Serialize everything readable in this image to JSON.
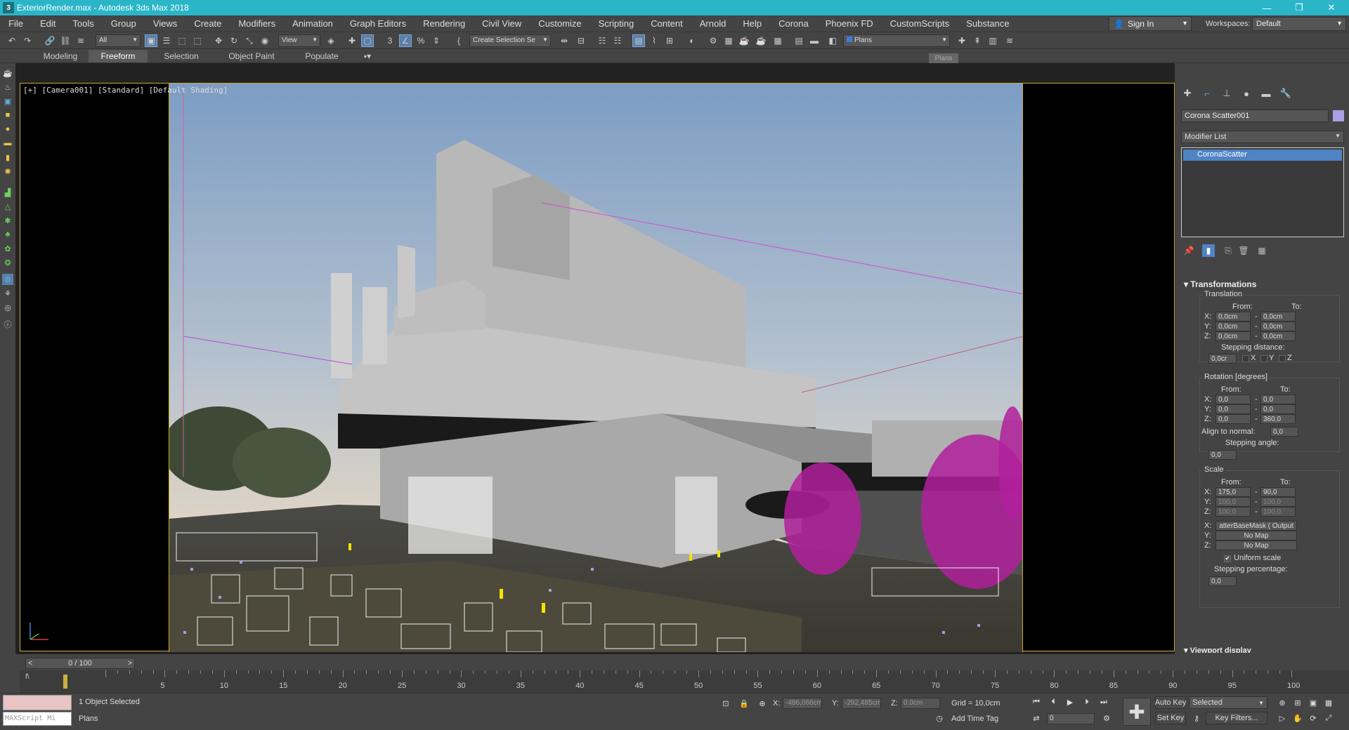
{
  "window": {
    "title": "ExteriorRender.max - Autodesk 3ds Max 2018",
    "app_icon": "3ds-max-icon"
  },
  "menu": [
    "File",
    "Edit",
    "Tools",
    "Group",
    "Views",
    "Create",
    "Modifiers",
    "Animation",
    "Graph Editors",
    "Rendering",
    "Civil View",
    "Customize",
    "Scripting",
    "Content",
    "Arnold",
    "Help",
    "Corona",
    "Phoenix FD",
    "CustomScripts",
    "Substance"
  ],
  "signin": {
    "label": "Sign In"
  },
  "workspaces": {
    "label": "Workspaces:",
    "value": "Default"
  },
  "toolbar": {
    "filter_value": "All",
    "refcoord_value": "View",
    "selection_set_value": "Create Selection Se",
    "layer_value": "Plans"
  },
  "ribbon": {
    "tabs": [
      "Modeling",
      "Freeform",
      "Selection",
      "Object Paint",
      "Populate"
    ],
    "active": "Freeform"
  },
  "tooltip": "Plans",
  "viewport": {
    "label": "[+] [Camera001] [Standard] [Default Shading]"
  },
  "command_panel": {
    "object_name": "Corona Scatter001",
    "object_color": "#a9a0e8",
    "modifier_list_label": "Modifier List",
    "modifier_stack": [
      "CoronaScatter"
    ],
    "rollout_title": "Transformations",
    "translation": {
      "title": "Translation",
      "from_label": "From:",
      "to_label": "To:",
      "rows": [
        {
          "axis": "X:",
          "from": "0,0cm",
          "to": "0,0cm"
        },
        {
          "axis": "Y:",
          "from": "0,0cm",
          "to": "0,0cm"
        },
        {
          "axis": "Z:",
          "from": "0,0cm",
          "to": "0,0cm"
        }
      ],
      "stepping_label": "Stepping distance:",
      "stepping_value": "0,0cr"
    },
    "rotation": {
      "title": "Rotation [degrees]",
      "from_label": "From:",
      "to_label": "To:",
      "rows": [
        {
          "axis": "X:",
          "from": "0,0",
          "to": "0,0"
        },
        {
          "axis": "Y:",
          "from": "0,0",
          "to": "0,0"
        },
        {
          "axis": "Z:",
          "from": "0,0",
          "to": "360,0"
        }
      ],
      "align_label": "Align to normal:",
      "align_value": "0,0",
      "stepping_label": "Stepping angle:",
      "stepping_value": "0,0"
    },
    "scale": {
      "title": "Scale",
      "from_label": "From:",
      "to_label": "To:",
      "rows": [
        {
          "axis": "X:",
          "from": "175,0",
          "to": "90,0"
        },
        {
          "axis": "Y:",
          "from": "100,0",
          "to": "100,0"
        },
        {
          "axis": "Z:",
          "from": "100,0",
          "to": "100,0"
        }
      ],
      "maps": [
        {
          "axis": "X:",
          "value": "atterBaseMask ( Output"
        },
        {
          "axis": "Y:",
          "value": "No Map"
        },
        {
          "axis": "Z:",
          "value": "No Map"
        }
      ],
      "uniform_label": "Uniform scale",
      "stepping_label": "Stepping percentage:",
      "stepping_value": "0,0"
    },
    "axes": [
      "X",
      "Y",
      "Z"
    ],
    "next_rollout": "Viewport display"
  },
  "timeline": {
    "frame_display": "0 / 100",
    "ticks": [
      "5",
      "10",
      "15",
      "20",
      "25",
      "30",
      "35",
      "40",
      "45",
      "50",
      "55",
      "60",
      "65",
      "70",
      "75",
      "80",
      "85",
      "90",
      "95",
      "100"
    ]
  },
  "status": {
    "selected": "1 Object Selected",
    "prompt": "Plans",
    "maxscript": "MAXScript Mi",
    "x_label": "X:",
    "x_value": "-486,066cm",
    "y_label": "Y:",
    "y_value": "-292,485cm",
    "z_label": "Z:",
    "z_value": "0,0cm",
    "grid": "Grid = 10,0cm",
    "add_time_tag": "Add Time Tag",
    "auto_key": "Auto Key",
    "set_key": "Set Key",
    "key_mode": "Selected",
    "key_filters": "Key Filters...",
    "current_frame": "0"
  }
}
